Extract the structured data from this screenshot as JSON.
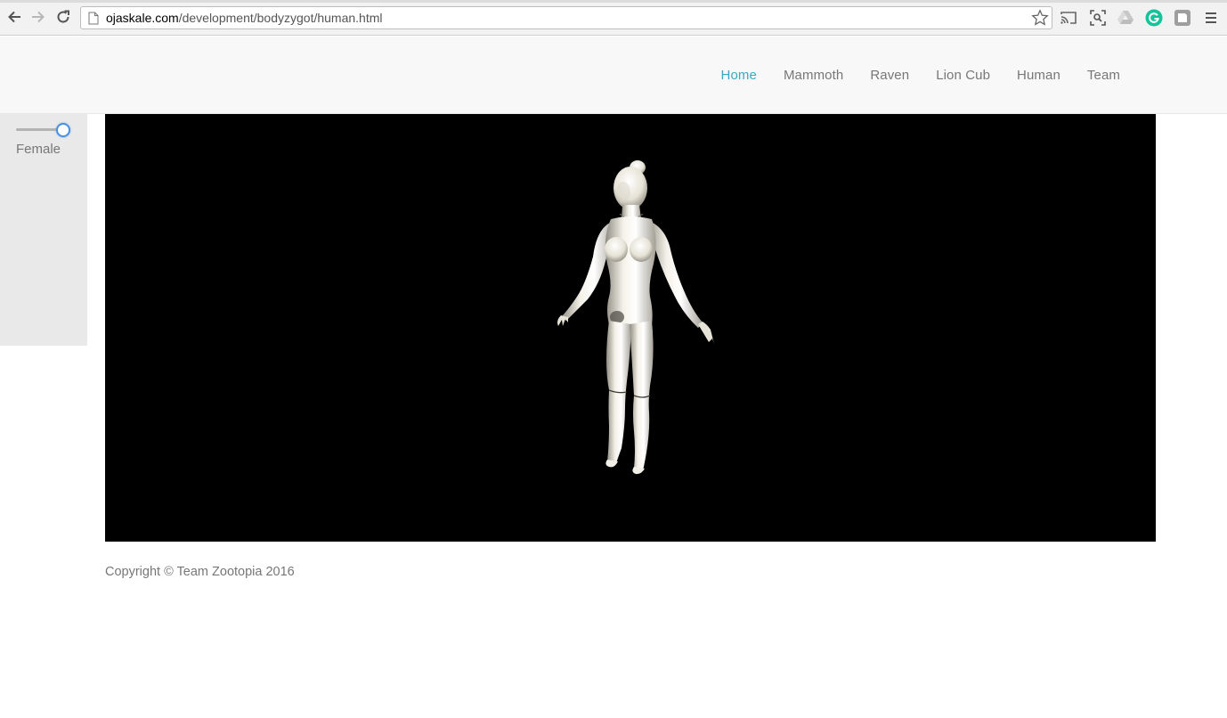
{
  "browser": {
    "url_host": "ojaskale.com",
    "url_path": "/development/bodyzygot/human.html"
  },
  "nav": {
    "items": [
      {
        "label": "Home",
        "active": true
      },
      {
        "label": "Mammoth",
        "active": false
      },
      {
        "label": "Raven",
        "active": false
      },
      {
        "label": "Lion Cub",
        "active": false
      },
      {
        "label": "Human",
        "active": false
      },
      {
        "label": "Team",
        "active": false
      }
    ],
    "active_color": "#3aa9c0",
    "text_color": "#777777"
  },
  "controls": {
    "gender_slider_value": 1,
    "gender_label": "Female"
  },
  "viewer": {
    "background": "#000000",
    "model": "female-human-3d-model"
  },
  "footer": {
    "copyright": "Copyright © Team Zootopia 2016"
  }
}
